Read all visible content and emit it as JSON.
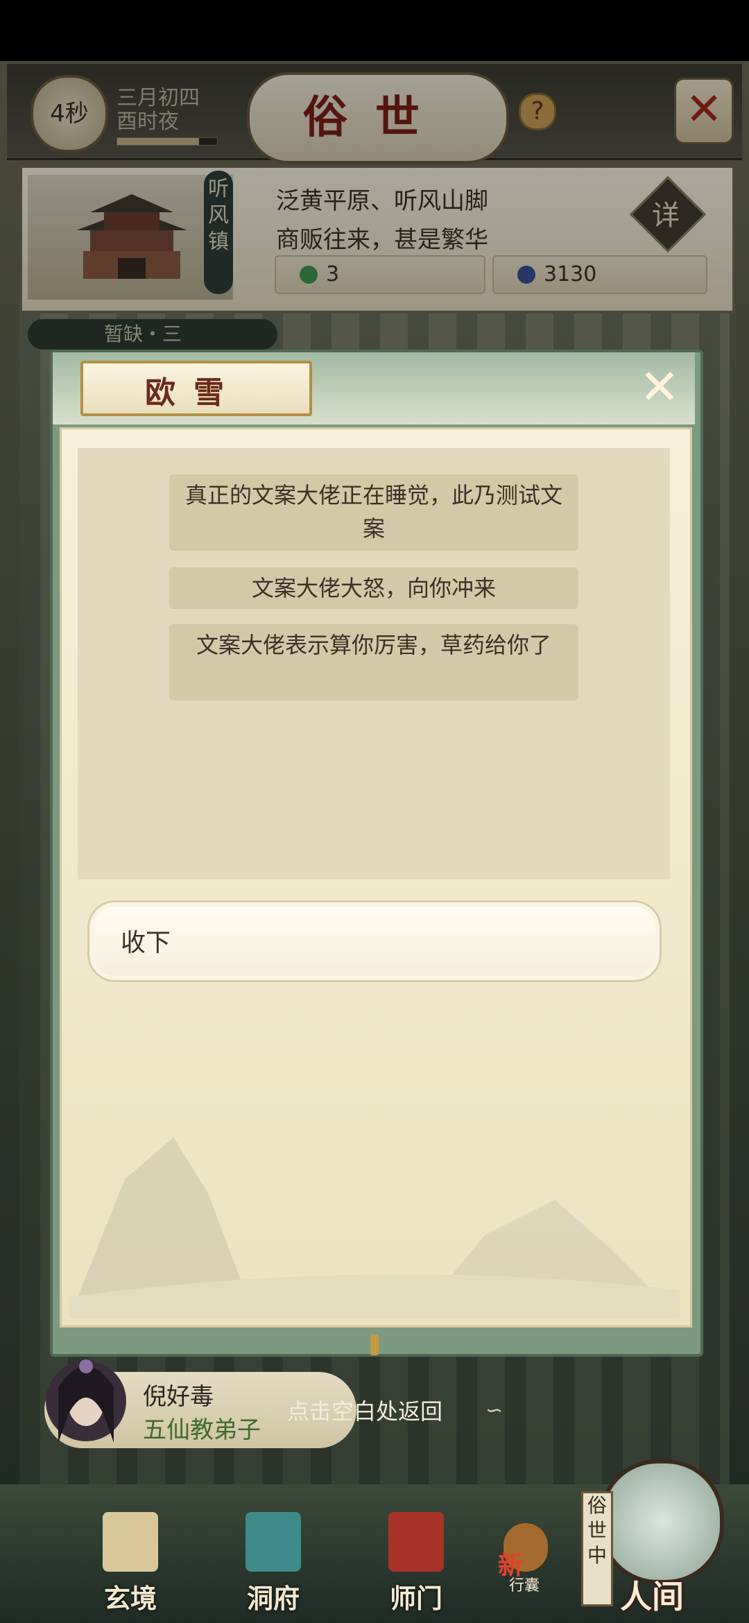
{
  "header": {
    "timer": "4秒",
    "date_line1": "三月初四",
    "date_line2": "酉时夜",
    "date_progress": 0.82,
    "title": "俗世",
    "help_icon": "?",
    "close_icon": "✕"
  },
  "location": {
    "tag": "听风镇",
    "desc_line1": "泛黄平原、听风山脚",
    "desc_line2": "商贩往来，甚是繁华",
    "detail_label": "详",
    "resources": [
      {
        "icon": "jade-icon",
        "value": "3",
        "color": "#3f9a52"
      },
      {
        "icon": "spirit-orb-icon",
        "value": "3130",
        "color": "#3b4f9a"
      }
    ],
    "sub_banner": "暂缺・三"
  },
  "dialog": {
    "npc_name": "欧雪",
    "log": [
      "真正的文案大佬正在睡觉，此乃测试文案",
      "文案大佬大怒，向你冲来",
      "文案大佬表示算你厉害，草药给你了"
    ],
    "choices": [
      "收下"
    ]
  },
  "character": {
    "name": "倪好毒",
    "role": "五仙教弟子"
  },
  "hint": "点击空白处返回",
  "nav": {
    "items": [
      "玄境",
      "洞府",
      "师门",
      "行囊"
    ],
    "new_badge": "新",
    "world_tag": "俗世中",
    "world_label": "人间"
  },
  "colors": {
    "title_red": "#7c1f16",
    "dialog_green": "#7c9a7f",
    "role_green": "#3f6b2d"
  }
}
